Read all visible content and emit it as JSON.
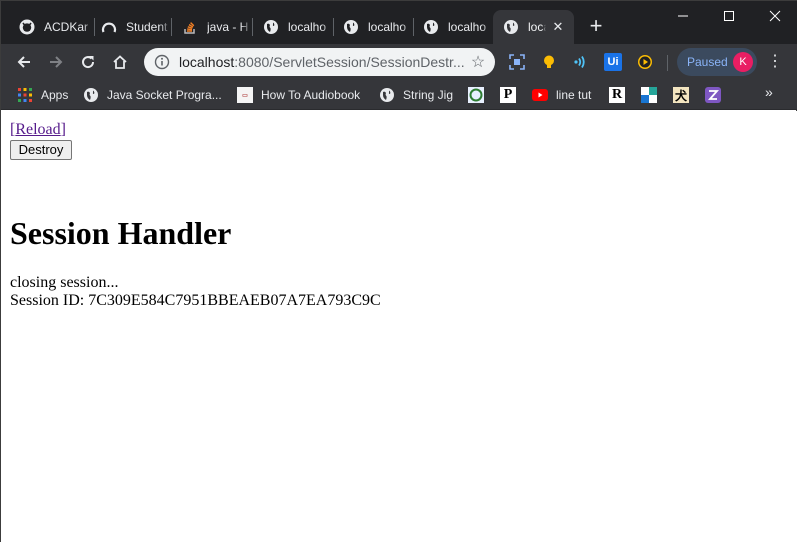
{
  "tabs": [
    {
      "title": "ACDKar",
      "icon": "github-icon"
    },
    {
      "title": "Student",
      "icon": "github-icon"
    },
    {
      "title": "java - H",
      "icon": "stackoverflow-icon"
    },
    {
      "title": "localho",
      "icon": "globe-icon"
    },
    {
      "title": "localho",
      "icon": "globe-icon"
    },
    {
      "title": "localho",
      "icon": "globe-icon"
    },
    {
      "title": "loca",
      "icon": "globe-icon",
      "active": true
    }
  ],
  "toolbar": {
    "url_host": "localhost",
    "url_rest": ":8080/ServletSession/SessionDestr...",
    "profile_label": "Paused",
    "profile_initial": "K"
  },
  "bookmarks": [
    {
      "label": "Apps",
      "icon": "apps-grid-icon"
    },
    {
      "label": "Java Socket Progra...",
      "icon": "globe-icon"
    },
    {
      "label": "How To Audiobook",
      "icon": "audiobook-icon"
    },
    {
      "label": "String Jig",
      "icon": "globe-icon"
    },
    {
      "label": "",
      "icon": "circle-bookmark-icon"
    },
    {
      "label": "",
      "icon": "p-bookmark-icon"
    },
    {
      "label": "line tut",
      "icon": "youtube-icon"
    },
    {
      "label": "",
      "icon": "r-bookmark-icon"
    },
    {
      "label": "",
      "icon": "blue-square-icon"
    },
    {
      "label": "",
      "icon": "kanji-icon"
    },
    {
      "label": "",
      "icon": "purple-icon"
    }
  ],
  "colors": {
    "titlebar": "#202124",
    "toolbar": "#35363a",
    "link_visited": "#551a8b",
    "avatar": "#e91e63"
  },
  "page": {
    "reload_open": "[",
    "reload_label": "Reload",
    "reload_close": "]",
    "destroy_label": "Destroy",
    "heading": "Session Handler",
    "status": "closing session...",
    "session_id": "Session ID: 7C309E584C7951BBEAEB07A7EA793C9C"
  }
}
